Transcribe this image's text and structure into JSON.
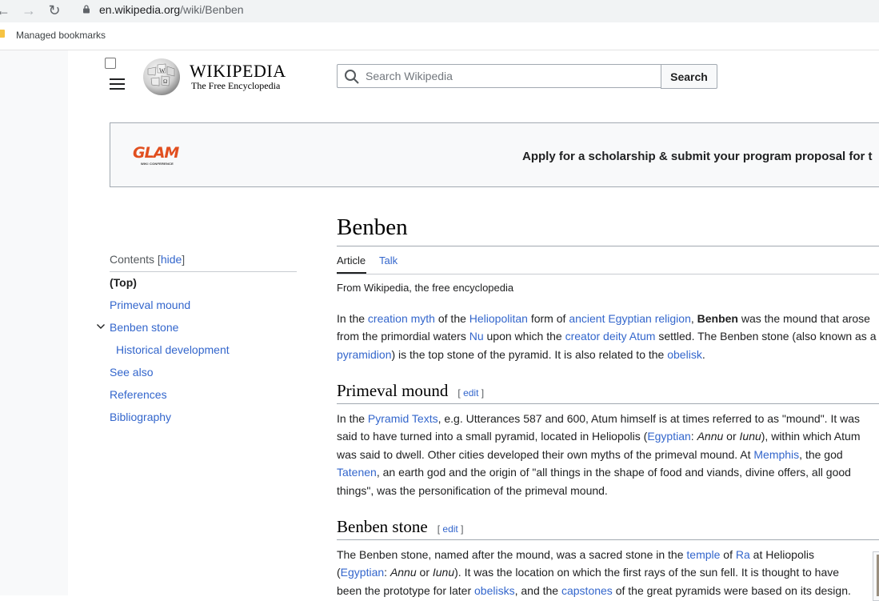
{
  "browser": {
    "url_domain": "en.wikipedia.org",
    "url_path": "/wiki/Benben",
    "bookmark_label": "Managed bookmarks"
  },
  "header": {
    "wordmark": "WIKIPEDIA",
    "tagline": "The Free Encyclopedia",
    "search_placeholder": "Search Wikipedia",
    "search_button": "Search"
  },
  "banner": {
    "logo_text": "GLAM",
    "logo_subtext": "WIKI CONFERENCE",
    "text": "Apply for a scholarship & submit your program proposal for t"
  },
  "toc": {
    "title": "Contents",
    "hide_label": "hide",
    "items": [
      "(Top)",
      "Primeval mound",
      "Benben stone",
      "Historical development",
      "See also",
      "References",
      "Bibliography"
    ]
  },
  "article": {
    "title": "Benben",
    "tabs": [
      "Article",
      "Talk"
    ],
    "from": "From Wikipedia, the free encyclopedia",
    "intro": {
      "l1": [
        "In the ",
        "creation myth",
        " of the ",
        "Heliopolitan",
        " form of ",
        "ancient Egyptian religion",
        ", ",
        "Benben",
        " was the mound that arose"
      ],
      "l2": [
        "from the primordial waters ",
        "Nu",
        " upon which the ",
        "creator deity",
        " ",
        "Atum",
        " settled. The Benben stone (also known as a"
      ],
      "l3": [
        "pyramidion",
        ") is the top stone of the pyramid. It is also related to the ",
        "obelisk",
        "."
      ]
    },
    "s1": {
      "heading": "Primeval mound",
      "edit": "edit",
      "l1": [
        "In the ",
        "Pyramid Texts",
        ", e.g. Utterances 587 and 600, Atum himself is at times referred to as \"mound\". It was"
      ],
      "l2": [
        "said to have turned into a small pyramid, located in Heliopolis (",
        "Egyptian",
        ": ",
        "Annu",
        " or ",
        "Iunu",
        "), within which Atum"
      ],
      "l3": [
        "was said to dwell. Other cities developed their own myths of the primeval mound. At ",
        "Memphis",
        ", the god"
      ],
      "l4": [
        "Tatenen",
        ", an earth god and the origin of \"all things in the shape of food and viands, divine offers, all good"
      ],
      "l5": [
        "things\", was the personification of the primeval mound."
      ]
    },
    "s2": {
      "heading": "Benben stone",
      "edit": "edit",
      "l1": [
        "The Benben stone, named after the mound, was a sacred stone in the ",
        "temple",
        " of ",
        "Ra",
        " at Heliopolis"
      ],
      "l2": [
        "(",
        "Egyptian",
        ": ",
        "Annu",
        " or ",
        "Iunu",
        "). It was the location on which the first rays of the sun fell. It is thought to have"
      ],
      "l3": [
        "been the prototype for later ",
        "obelisks",
        ", and the ",
        "capstones",
        " of the great pyramids were based on its design."
      ]
    }
  }
}
